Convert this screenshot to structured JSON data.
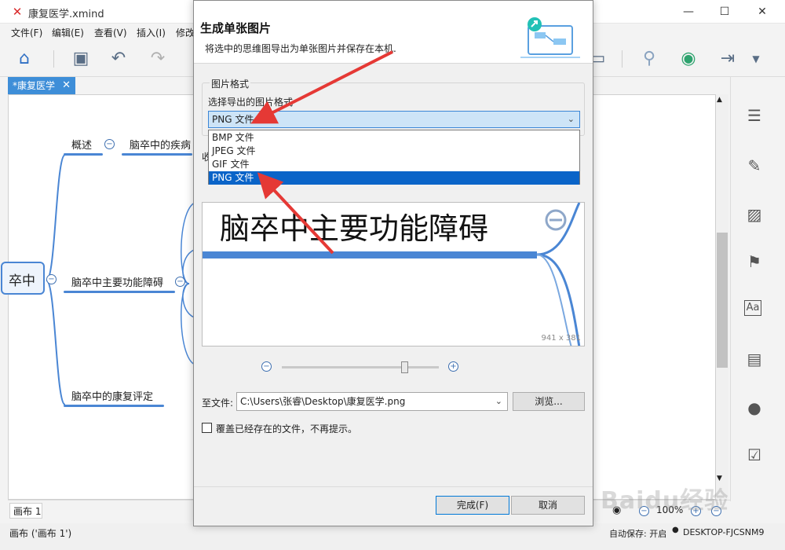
{
  "app": {
    "title": "康复医学.xmind",
    "window_controls": [
      "—",
      "☐",
      "✕"
    ]
  },
  "menu": [
    "文件(F)",
    "编辑(E)",
    "查看(V)",
    "插入(I)",
    "修改"
  ],
  "doc_tab": {
    "label": "*康复医学",
    "close": "✕"
  },
  "mindmap": {
    "root_partial": "卒中",
    "branches": [
      "概述",
      "脑卒中主要功能障碍",
      "脑卒中的康复评定"
    ],
    "sub_partial": "脑卒中的疾病"
  },
  "dialog": {
    "heading": "生成单张图片",
    "subheading": "将选中的思维图导出为单张图片并保存在本机.",
    "group_label": "图片格式",
    "format_label": "选择导出的图片格式",
    "selected_format": "PNG 文件",
    "format_options": [
      "BMP 文件",
      "JPEG 文件",
      "GIF 文件",
      "PNG 文件"
    ],
    "hidden_row_label": "收",
    "preview": {
      "text": "脑卒中主要功能障碍",
      "size": "941 x 381"
    },
    "zoom_out": "−",
    "zoom_in": "+",
    "zoom_level": 0.78,
    "file_label": "至文件:",
    "file_path": "C:\\Users\\张睿\\Desktop\\康复医学.png",
    "browse": "浏览...",
    "overwrite_label": "覆盖已经存在的文件，不再提示。",
    "finish": "完成(F)",
    "cancel": "取消"
  },
  "bottom": {
    "sheet_tab": "画布 1",
    "zoom": "100%"
  },
  "status": {
    "left": "画布 ('画布 1')",
    "autosave": "自动保存: 开启",
    "computer": "DESKTOP-FJCSNM9"
  },
  "colors": {
    "accent": "#3e8ed8",
    "branch_line": "#4a86d4",
    "selection": "#0a64c8",
    "arrow": "#e53935"
  }
}
